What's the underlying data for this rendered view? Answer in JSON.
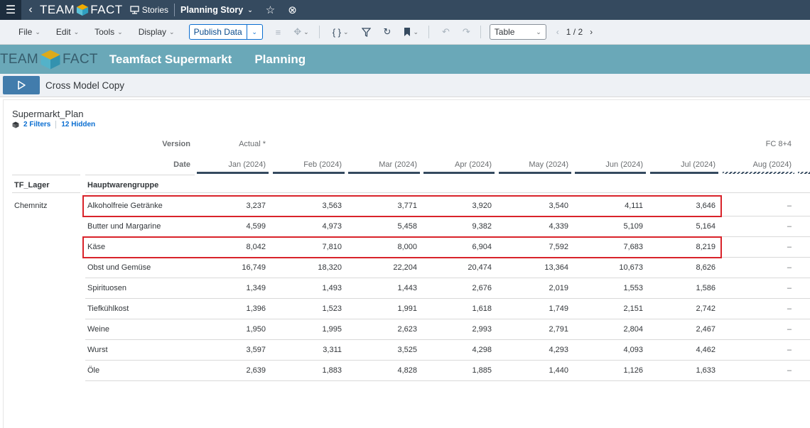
{
  "shell": {
    "logo_left": "TEAM",
    "logo_right": "FACT",
    "stories": "Stories",
    "story_title": "Planning Story"
  },
  "toolbar": {
    "file": "File",
    "edit": "Edit",
    "tools": "Tools",
    "display": "Display",
    "publish": "Publish Data",
    "view_select": "Table",
    "page": "1 / 2"
  },
  "banner": {
    "logo_left": "TEAM",
    "logo_right": "FACT",
    "title": "Teamfact Supermarkt",
    "subtitle": "Planning"
  },
  "action": {
    "label": "Cross Model Copy"
  },
  "panel": {
    "title": "Supermarkt_Plan",
    "filters": "2 Filters",
    "hidden": "12 Hidden"
  },
  "table": {
    "version_label": "Version",
    "date_label": "Date",
    "version_actual": "Actual *",
    "version_fc": "FC 8+4",
    "dim1_header": "TF_Lager",
    "dim2_header": "Hauptwarengruppe",
    "dates": [
      "Jan (2024)",
      "Feb (2024)",
      "Mar (2024)",
      "Apr (2024)",
      "May (2024)",
      "Jun (2024)",
      "Jul (2024)",
      "Aug (2024)"
    ],
    "rows": [
      {
        "lager": "Chemnitz",
        "group": "Alkoholfreie Getränke",
        "values": [
          "3,237",
          "3,563",
          "3,771",
          "3,920",
          "3,540",
          "4,111",
          "3,646",
          "–"
        ],
        "highlight": true
      },
      {
        "lager": "",
        "group": "Butter und Margarine",
        "values": [
          "4,599",
          "4,973",
          "5,458",
          "9,382",
          "4,339",
          "5,109",
          "5,164",
          "–"
        ],
        "highlight": false
      },
      {
        "lager": "",
        "group": "Käse",
        "values": [
          "8,042",
          "7,810",
          "8,000",
          "6,904",
          "7,592",
          "7,683",
          "8,219",
          "–"
        ],
        "highlight": true
      },
      {
        "lager": "",
        "group": "Obst und Gemüse",
        "values": [
          "16,749",
          "18,320",
          "22,204",
          "20,474",
          "13,364",
          "10,673",
          "8,626",
          "–"
        ],
        "highlight": false
      },
      {
        "lager": "",
        "group": "Spirituosen",
        "values": [
          "1,349",
          "1,493",
          "1,443",
          "2,676",
          "2,019",
          "1,553",
          "1,586",
          "–"
        ],
        "highlight": false
      },
      {
        "lager": "",
        "group": "Tiefkühlkost",
        "values": [
          "1,396",
          "1,523",
          "1,991",
          "1,618",
          "1,749",
          "2,151",
          "2,742",
          "–"
        ],
        "highlight": false
      },
      {
        "lager": "",
        "group": "Weine",
        "values": [
          "1,950",
          "1,995",
          "2,623",
          "2,993",
          "2,791",
          "2,804",
          "2,467",
          "–"
        ],
        "highlight": false
      },
      {
        "lager": "",
        "group": "Wurst",
        "values": [
          "3,597",
          "3,311",
          "3,525",
          "4,298",
          "4,293",
          "4,093",
          "4,462",
          "–"
        ],
        "highlight": false
      },
      {
        "lager": "",
        "group": "Öle",
        "values": [
          "2,639",
          "1,883",
          "4,828",
          "1,885",
          "1,440",
          "1,126",
          "1,633",
          "–"
        ],
        "highlight": false
      }
    ]
  }
}
